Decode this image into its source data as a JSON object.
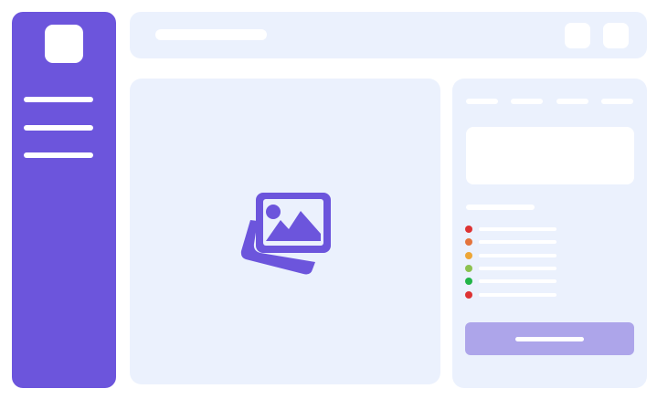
{
  "colors": {
    "accent": "#6c55dc",
    "panel": "#ebf1fd",
    "button": "#ada5ea",
    "white": "#ffffff"
  },
  "sidebar": {
    "logo_icon": "app-logo-icon",
    "items": [
      {
        "label": ""
      },
      {
        "label": ""
      },
      {
        "label": ""
      }
    ]
  },
  "topbar": {
    "title": "",
    "buttons": [
      {
        "icon": "square-button-icon"
      },
      {
        "icon": "square-button-icon"
      }
    ]
  },
  "main": {
    "placeholder_icon": "image-gallery-icon"
  },
  "details": {
    "tabs": [
      {
        "label": ""
      },
      {
        "label": ""
      },
      {
        "label": ""
      },
      {
        "label": ""
      }
    ],
    "section_title": "",
    "list_items": [
      {
        "color": "#dd3333",
        "label": ""
      },
      {
        "color": "#e4743c",
        "label": ""
      },
      {
        "color": "#eda637",
        "label": ""
      },
      {
        "color": "#8cc14f",
        "label": ""
      },
      {
        "color": "#22b447",
        "label": ""
      },
      {
        "color": "#dd3333",
        "label": ""
      }
    ],
    "action_button_label": ""
  }
}
